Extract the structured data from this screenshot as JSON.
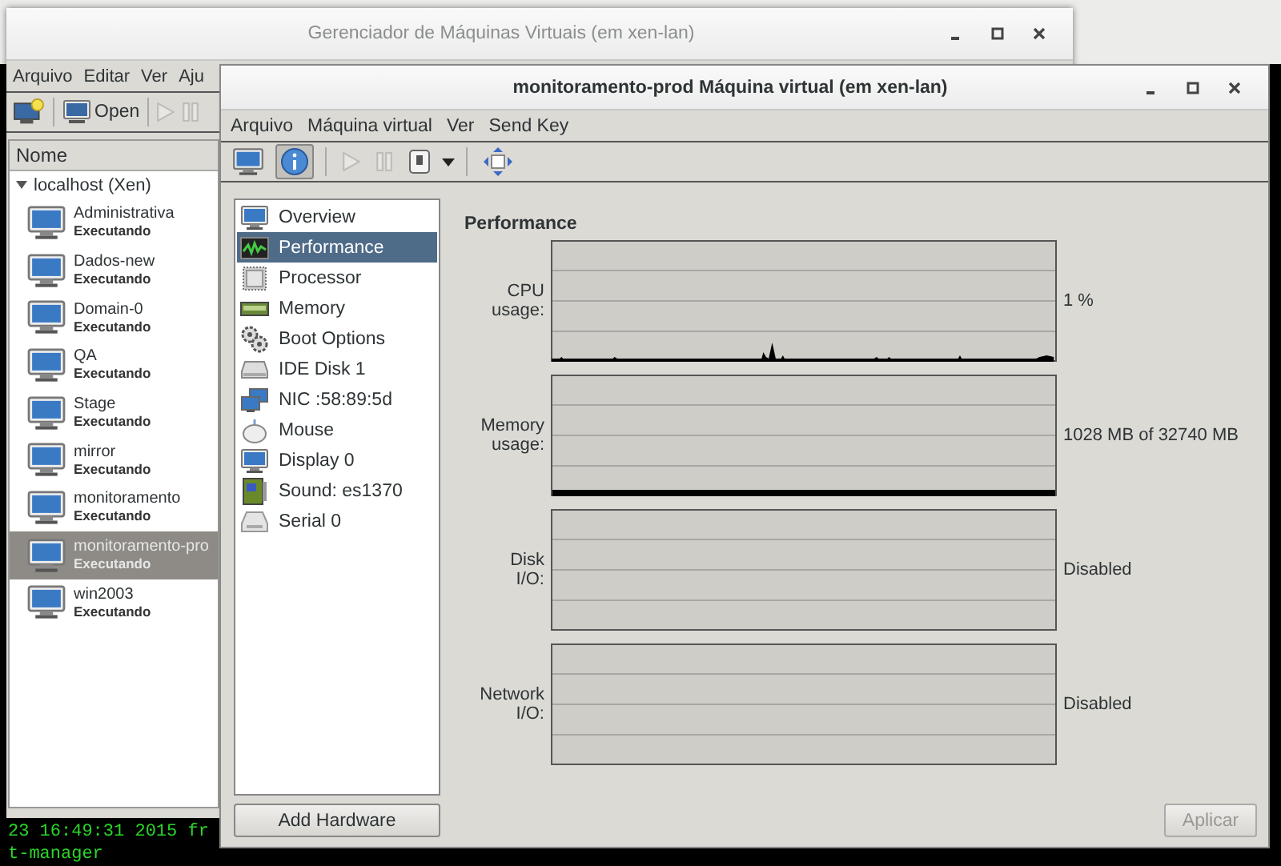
{
  "desktop": {
    "terminal_lines": [
      "23 16:49:31 2015 fr",
      "t-manager"
    ]
  },
  "manager_window": {
    "title": "Gerenciador de Máquinas Virtuais (em xen-lan)",
    "menu": [
      "Arquivo",
      "Editar",
      "Ver",
      "Aju"
    ],
    "toolbar": [
      {
        "kind": "new",
        "disabled": false
      },
      {
        "kind": "open",
        "label": "Open",
        "disabled": false
      },
      {
        "kind": "run",
        "disabled": true
      },
      {
        "kind": "pause",
        "disabled": true
      }
    ],
    "list": {
      "column": "Nome",
      "host": {
        "label": "localhost (Xen)",
        "expanded": true,
        "children": [
          {
            "name": "Administrativa",
            "status": "Executando",
            "selected": false
          },
          {
            "name": "Dados-new",
            "status": "Executando",
            "selected": false
          },
          {
            "name": "Domain-0",
            "status": "Executando",
            "selected": false
          },
          {
            "name": "QA",
            "status": "Executando",
            "selected": false
          },
          {
            "name": "Stage",
            "status": "Executando",
            "selected": false
          },
          {
            "name": "mirror",
            "status": "Executando",
            "selected": false
          },
          {
            "name": "monitoramento",
            "status": "Executando",
            "selected": false
          },
          {
            "name": "monitoramento-pro",
            "status": "Executando",
            "selected": true
          },
          {
            "name": "win2003",
            "status": "Executando",
            "selected": false
          }
        ]
      }
    }
  },
  "vm_window": {
    "title": "monitoramento-prod Máquina virtual (em xen-lan)",
    "menu": [
      "Arquivo",
      "Máquina virtual",
      "Ver",
      "Send Key"
    ],
    "view_buttons": [
      {
        "kind": "console",
        "selected": false
      },
      {
        "kind": "details",
        "selected": true
      }
    ],
    "action_buttons": [
      {
        "kind": "run",
        "disabled": true
      },
      {
        "kind": "pause",
        "disabled": true
      },
      {
        "kind": "shutdown",
        "disabled": false
      },
      {
        "kind": "fullscreen",
        "disabled": false
      }
    ],
    "hardware": [
      {
        "label": "Overview",
        "kind": "overview",
        "selected": false
      },
      {
        "label": "Performance",
        "kind": "performance",
        "selected": true
      },
      {
        "label": "Processor",
        "kind": "processor",
        "selected": false
      },
      {
        "label": "Memory",
        "kind": "memory",
        "selected": false
      },
      {
        "label": "Boot Options",
        "kind": "boot",
        "selected": false
      },
      {
        "label": "IDE Disk 1",
        "kind": "disk",
        "selected": false
      },
      {
        "label": "NIC :58:89:5d",
        "kind": "nic",
        "selected": false
      },
      {
        "label": "Mouse",
        "kind": "mouse",
        "selected": false
      },
      {
        "label": "Display 0",
        "kind": "display",
        "selected": false
      },
      {
        "label": "Sound: es1370",
        "kind": "sound",
        "selected": false
      },
      {
        "label": "Serial 0",
        "kind": "serial",
        "selected": false
      }
    ],
    "add_hardware": "Add Hardware",
    "section_title": "Performance",
    "graphs": [
      {
        "label": "CPU usage:",
        "reading": "1 %",
        "kind": "cpu"
      },
      {
        "label": "Memory usage:",
        "reading": "1028 MB of 32740 MB",
        "kind": "memory"
      },
      {
        "label": "Disk I/O:",
        "reading": "Disabled",
        "kind": "empty"
      },
      {
        "label": "Network I/O:",
        "reading": "Disabled",
        "kind": "empty"
      }
    ],
    "apply": {
      "label": "Aplicar",
      "disabled": true
    }
  }
}
